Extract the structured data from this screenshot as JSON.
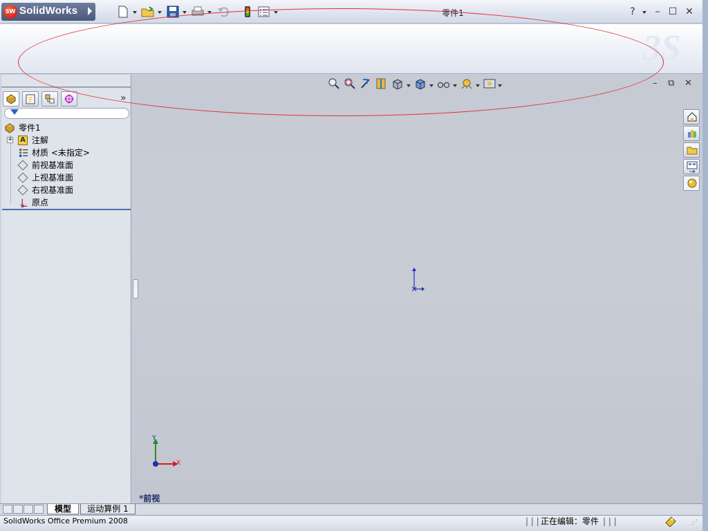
{
  "app": {
    "logo_badge": "SW",
    "name": "SolidWorks",
    "document_title": "零件1",
    "help_symbol": "?",
    "minimize_symbol": "–",
    "maximize_symbol": "☐",
    "close_symbol": "✕"
  },
  "toolbar": {
    "icons": [
      "new-document-icon",
      "open-folder-icon",
      "save-icon",
      "print-icon",
      "undo-icon",
      "rebuild-icon",
      "options-icon"
    ]
  },
  "heads_up_toolbar": {
    "icons": [
      "zoom-to-fit-icon",
      "zoom-to-area-icon",
      "previous-view-icon",
      "section-view-icon",
      "view-orientation-icon",
      "display-style-icon",
      "hide-show-items-icon",
      "edit-appearance-icon",
      "apply-scene-icon"
    ]
  },
  "feature_manager": {
    "tabs": [
      "featuremanager-tab",
      "propertymanager-tab",
      "configurationmanager-tab",
      "dimxpert-tab"
    ],
    "expand_symbol": "»",
    "tree": {
      "root": "零件1",
      "items": [
        {
          "label": "注解",
          "icon": "annotations-icon",
          "expand": "+"
        },
        {
          "label": "材质 <未指定>",
          "icon": "material-icon"
        },
        {
          "label": "前视基准面",
          "icon": "plane-icon"
        },
        {
          "label": "上视基准面",
          "icon": "plane-icon"
        },
        {
          "label": "右视基准面",
          "icon": "plane-icon"
        },
        {
          "label": "原点",
          "icon": "origin-icon"
        }
      ]
    }
  },
  "graphics": {
    "view_name": "*前视",
    "triad_x": "X",
    "triad_y": "Y",
    "doc_min": "–",
    "doc_restore": "⧉",
    "doc_close": "✕"
  },
  "task_pane": {
    "tabs": [
      "solidworks-resources-icon",
      "design-library-icon",
      "file-explorer-icon",
      "view-palette-icon",
      "appearances-icon"
    ]
  },
  "bottom_tabs": {
    "model": "模型",
    "motion_study": "运动算例 1"
  },
  "status_bar": {
    "product": "SolidWorks Office Premium 2008",
    "editing": "正在编辑：零件"
  },
  "colors": {
    "annotation_ellipse": "#e0303a",
    "origin_blue": "#1c2fb6",
    "accent_blue": "#4a6fae"
  }
}
